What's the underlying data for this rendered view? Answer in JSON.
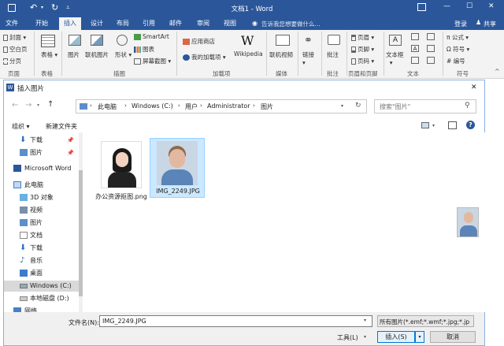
{
  "titlebar": {
    "title": "文档1 - Word",
    "help": "?",
    "minimize": "—",
    "maximize": "☐",
    "close": "✕"
  },
  "tabs": [
    {
      "label": "文件"
    },
    {
      "label": "开始"
    },
    {
      "label": "插入"
    },
    {
      "label": "设计"
    },
    {
      "label": "布局"
    },
    {
      "label": "引用"
    },
    {
      "label": "邮件"
    },
    {
      "label": "审阅"
    },
    {
      "label": "视图"
    }
  ],
  "tellme": "告诉我您想要做什么...",
  "login": "登录",
  "share": "共享",
  "ribbon": {
    "pages": {
      "cover": "封面",
      "blank": "空白页",
      "break": "分页",
      "group": "页面"
    },
    "table": {
      "label": "表格",
      "group": "表格"
    },
    "illus": {
      "pic": "图片",
      "online": "联机图片",
      "shapes": "形状",
      "smartart": "SmartArt",
      "chart": "图表",
      "screenshot": "屏幕截图",
      "group": "插图"
    },
    "addins": {
      "store": "应用商店",
      "myaddins": "我的加载项",
      "wikipedia": "Wikipedia",
      "group": "加载项"
    },
    "media": {
      "video": "联机视频",
      "group": "媒体"
    },
    "links": {
      "link": "链接"
    },
    "comments": {
      "comment": "批注",
      "group": "批注"
    },
    "hf": {
      "header": "页眉",
      "footer": "页脚",
      "pagenum": "页码",
      "group": "页眉和页脚"
    },
    "text": {
      "textbox": "文本框",
      "group": "文本"
    },
    "symbols": {
      "equation": "公式",
      "symbol": "符号",
      "number": "编号",
      "group": "符号"
    }
  },
  "dialog": {
    "title": "插入图片",
    "close": "✕",
    "breadcrumb": [
      "此电脑",
      "Windows (C:)",
      "用户",
      "Administrator",
      "图片"
    ],
    "search_placeholder": "搜索\"图片\"",
    "organize": "组织 ▾",
    "newfolder": "新建文件夹",
    "sidebar": [
      {
        "label": "下载",
        "icon": "download-icon"
      },
      {
        "label": "图片",
        "icon": "pictures-icon"
      },
      {
        "label": "Microsoft Word",
        "icon": "word-icon"
      },
      {
        "label": "此电脑",
        "icon": "computer-icon"
      },
      {
        "label": "3D 对象",
        "icon": "3d-objects-icon"
      },
      {
        "label": "视频",
        "icon": "video-icon"
      },
      {
        "label": "图片",
        "icon": "pictures-icon"
      },
      {
        "label": "文档",
        "icon": "documents-icon"
      },
      {
        "label": "下载",
        "icon": "download-icon"
      },
      {
        "label": "音乐",
        "icon": "music-icon"
      },
      {
        "label": "桌面",
        "icon": "desktop-icon"
      },
      {
        "label": "Windows (C:)",
        "icon": "drive-icon"
      },
      {
        "label": "本地磁盘 (D:)",
        "icon": "drive-icon"
      },
      {
        "label": "网络",
        "icon": "network-icon"
      }
    ],
    "files": [
      {
        "name": "办公资源抠图.png"
      },
      {
        "name": "IMG_2249.JPG"
      }
    ],
    "filename_label": "文件名(N):",
    "filename_value": "IMG_2249.JPG",
    "filetype": "所有图片(*.emf;*.wmf;*.jpg;*.jp",
    "tools": "工具(L)",
    "insert": "插入(S)",
    "cancel": "取消"
  },
  "colors": {
    "accent": "#2b579a",
    "selection": "#cce8ff"
  }
}
